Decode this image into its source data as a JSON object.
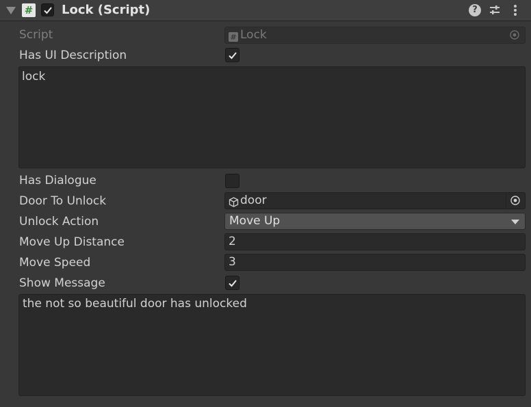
{
  "component": {
    "title": "Lock (Script)",
    "enabled": true,
    "script_icon_glyph": "#",
    "help_glyph": "?",
    "icons": {
      "foldout": "foldout-arrow-icon",
      "script": "csharp-script-icon",
      "help": "help-icon",
      "presets": "presets-sliders-icon",
      "menu": "kebab-menu-icon"
    }
  },
  "fields": {
    "script": {
      "label": "Script",
      "value": "Lock",
      "icon": "script-icon"
    },
    "has_ui_description": {
      "label": "Has UI Description",
      "checked": true
    },
    "ui_description": {
      "value": "lock"
    },
    "has_dialogue": {
      "label": "Has Dialogue",
      "checked": false
    },
    "door_to_unlock": {
      "label": "Door To Unlock",
      "value": "door",
      "icon": "gameobject-cube-icon"
    },
    "unlock_action": {
      "label": "Unlock Action",
      "value": "Move Up"
    },
    "move_up_distance": {
      "label": "Move Up Distance",
      "value": "2"
    },
    "move_speed": {
      "label": "Move Speed",
      "value": "3"
    },
    "show_message": {
      "label": "Show Message",
      "checked": true
    },
    "message": {
      "value": "the not so beautiful door has unlocked"
    }
  },
  "colors": {
    "background": "#383838",
    "header": "#3e3e3e",
    "field": "#2a2a2a",
    "dropdown": "#515151",
    "text": "#d2d2d2",
    "script_icon_green": "#3a8a3a"
  }
}
